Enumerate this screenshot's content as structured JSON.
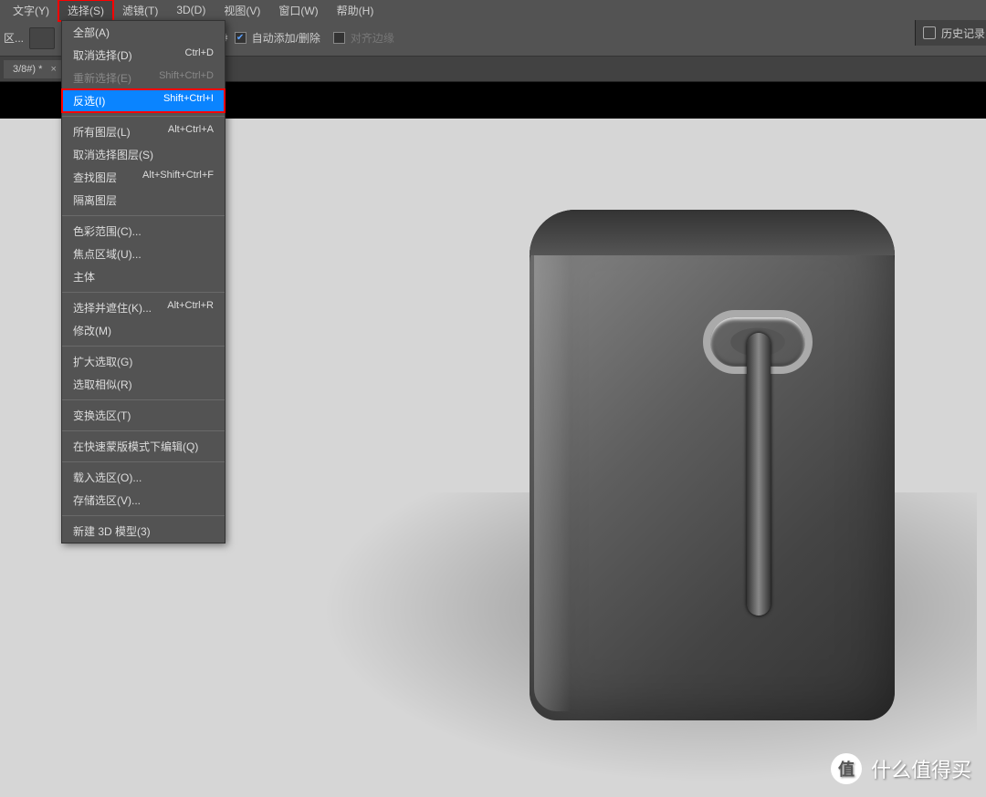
{
  "menubar": {
    "items": [
      {
        "label": "文字(Y)"
      },
      {
        "label": "选择(S)"
      },
      {
        "label": "滤镜(T)"
      },
      {
        "label": "3D(D)"
      },
      {
        "label": "视图(V)"
      },
      {
        "label": "窗口(W)"
      },
      {
        "label": "帮助(H)"
      }
    ],
    "active_index": 1
  },
  "toolbar": {
    "left_fragment": "区...",
    "auto_add_remove": "自动添加/删除",
    "align_edges": "对齐边缘"
  },
  "tabs": {
    "document": "3/8#) *",
    "close": "×"
  },
  "dropdown": {
    "groups": [
      [
        {
          "label": "全部(A)",
          "shortcut": ""
        },
        {
          "label": "取消选择(D)",
          "shortcut": "Ctrl+D"
        },
        {
          "label": "重新选择(E)",
          "shortcut": "Shift+Ctrl+D",
          "disabled": true
        },
        {
          "label": "反选(I)",
          "shortcut": "Shift+Ctrl+I",
          "highlight": true
        }
      ],
      [
        {
          "label": "所有图层(L)",
          "shortcut": "Alt+Ctrl+A"
        },
        {
          "label": "取消选择图层(S)",
          "shortcut": ""
        },
        {
          "label": "查找图层",
          "shortcut": "Alt+Shift+Ctrl+F"
        },
        {
          "label": "隔离图层",
          "shortcut": ""
        }
      ],
      [
        {
          "label": "色彩范围(C)...",
          "shortcut": ""
        },
        {
          "label": "焦点区域(U)...",
          "shortcut": ""
        },
        {
          "label": "主体",
          "shortcut": ""
        }
      ],
      [
        {
          "label": "选择并遮住(K)...",
          "shortcut": "Alt+Ctrl+R"
        },
        {
          "label": "修改(M)",
          "shortcut": ""
        }
      ],
      [
        {
          "label": "扩大选取(G)",
          "shortcut": ""
        },
        {
          "label": "选取相似(R)",
          "shortcut": ""
        }
      ],
      [
        {
          "label": "变换选区(T)",
          "shortcut": ""
        }
      ],
      [
        {
          "label": "在快速蒙版模式下编辑(Q)",
          "shortcut": ""
        }
      ],
      [
        {
          "label": "载入选区(O)...",
          "shortcut": ""
        },
        {
          "label": "存储选区(V)...",
          "shortcut": ""
        }
      ],
      [
        {
          "label": "新建 3D 模型(3)",
          "shortcut": ""
        }
      ]
    ]
  },
  "right_panel": {
    "label": "历史记录"
  },
  "watermark": {
    "symbol": "值",
    "text": "什么值得买"
  }
}
